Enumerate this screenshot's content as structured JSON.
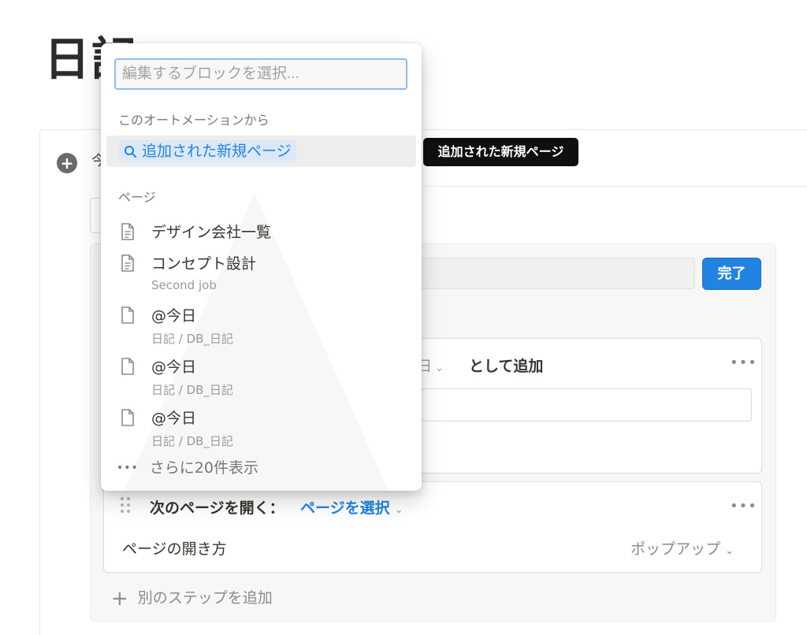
{
  "page": {
    "title": "日記",
    "peek_char": "今"
  },
  "automation": {
    "done_label": "完了",
    "step1": {
      "value_fragment": "日",
      "suffix": "として追加",
      "more_icon": "•••"
    },
    "step2": {
      "label": "次のページを開く：",
      "select_label": "ページを選択",
      "more_icon": "•••",
      "open_method_label": "ページの開き方",
      "open_method_value": "ポップアップ"
    },
    "add_step_label": "別のステップを追加"
  },
  "dropdown": {
    "search_placeholder": "編集するブロックを選択...",
    "section_automation": "このオートメーションから",
    "automation_item": "追加された新規ページ",
    "section_pages": "ページ",
    "pages": [
      {
        "title": "デザイン会社一覧",
        "subtitle": "",
        "icon": "document-text-icon"
      },
      {
        "title": "コンセプト設計",
        "subtitle": "Second job",
        "icon": "document-text-icon"
      },
      {
        "title": "@今日",
        "subtitle": "日記 / DB_日記",
        "icon": "document-icon"
      },
      {
        "title": "@今日",
        "subtitle": "日記 / DB_日記",
        "icon": "document-icon"
      },
      {
        "title": "@今日",
        "subtitle": "日記 / DB_日記",
        "icon": "document-icon"
      }
    ],
    "show_more_label": "さらに20件表示"
  },
  "tooltip": {
    "text": "追加された新規ページ"
  },
  "colors": {
    "accent": "#2383e2",
    "chip_bg": "#dbe9f6",
    "tooltip_bg": "#0f0f0f"
  }
}
